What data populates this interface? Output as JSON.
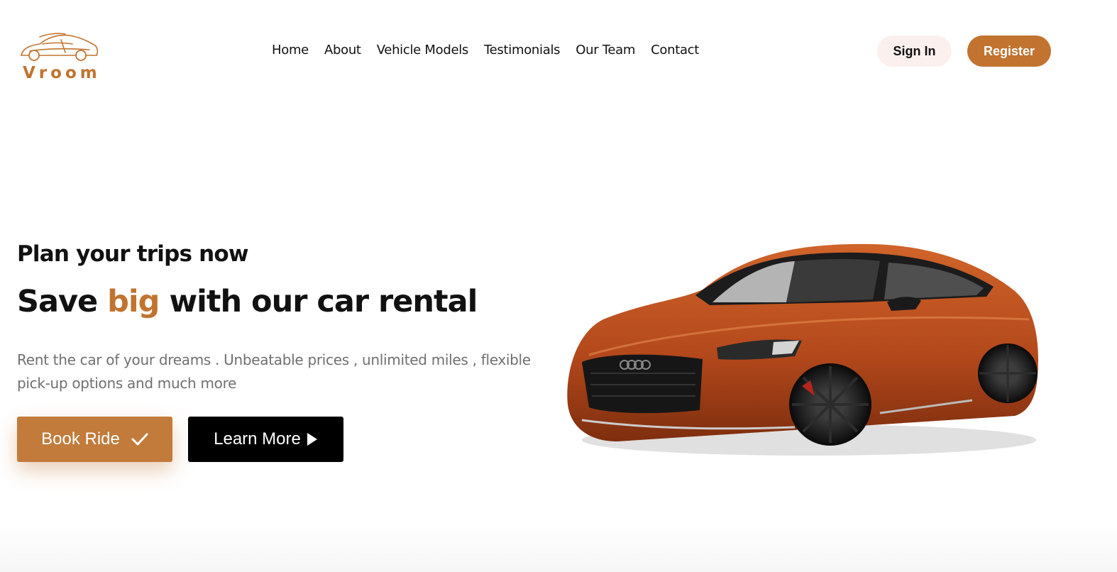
{
  "brand": {
    "name": "Vroom",
    "accent_color": "#c1732f"
  },
  "nav": {
    "items": [
      {
        "label": "Home"
      },
      {
        "label": "About"
      },
      {
        "label": "Vehicle Models"
      },
      {
        "label": "Testimonials"
      },
      {
        "label": "Our Team"
      },
      {
        "label": "Contact"
      }
    ]
  },
  "auth": {
    "signin_label": "Sign In",
    "register_label": "Register"
  },
  "hero": {
    "subtitle": "Plan your trips now",
    "title_prefix": "Save ",
    "title_accent": "big",
    "title_suffix": " with our car rental",
    "description": "Rent the car of your dreams . Unbeatable prices , unlimited miles , flexible pick-up options and much more",
    "book_label": "Book Ride",
    "book_icon": "check-icon",
    "learn_label": "Learn More",
    "learn_icon": "play-icon",
    "image": "orange-sportback-car"
  }
}
